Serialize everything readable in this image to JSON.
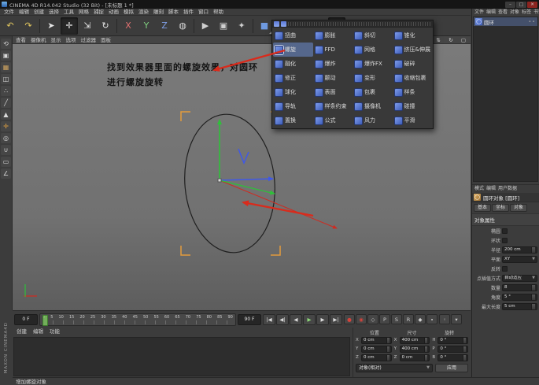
{
  "titlebar": {
    "title": "CINEMA 4D R14.042 Studio (32 Bit) - [未标题 1 *]",
    "minimize": "–",
    "maximize": "□",
    "close": "✕"
  },
  "menubar": {
    "items": [
      "文件",
      "编辑",
      "创建",
      "选择",
      "工具",
      "网格",
      "捕捉",
      "动画",
      "模拟",
      "渲染",
      "雕刻",
      "脚本",
      "插件",
      "窗口",
      "帮助"
    ]
  },
  "toolbar": {
    "icons": [
      {
        "name": "undo-icon",
        "glyph": "↶",
        "color": "#e3c75f"
      },
      {
        "name": "redo-icon",
        "glyph": "↷",
        "color": "#e3c75f"
      },
      {
        "sep": true
      },
      {
        "name": "live-selection-icon",
        "glyph": "➤",
        "color": "#e8e8e8"
      },
      {
        "name": "move-tool-icon",
        "glyph": "✛",
        "color": "#eeeeee",
        "pressed": true
      },
      {
        "name": "scale-tool-icon",
        "glyph": "⇲",
        "color": "#e8e8e8"
      },
      {
        "name": "rotate-tool-icon",
        "glyph": "↻",
        "color": "#e8e8e8"
      },
      {
        "sep": true
      },
      {
        "name": "lock-x-axis-icon",
        "glyph": "X",
        "color": "#e07070"
      },
      {
        "name": "lock-y-axis-icon",
        "glyph": "Y",
        "color": "#7fcf7f"
      },
      {
        "name": "lock-z-axis-icon",
        "glyph": "Z",
        "color": "#7f9fe8"
      },
      {
        "name": "coordinate-system-icon",
        "glyph": "◍",
        "color": "#d8d8d8"
      },
      {
        "sep": true
      },
      {
        "name": "render-view-icon",
        "glyph": "▶",
        "color": "#cfcfcf"
      },
      {
        "name": "render-picture-viewer-icon",
        "glyph": "▣",
        "color": "#cfcfcf"
      },
      {
        "name": "render-settings-icon",
        "glyph": "✦",
        "color": "#cfcfcf"
      },
      {
        "sep": true
      },
      {
        "name": "add-primitive-icon",
        "glyph": "■",
        "color": "#6f9ae0",
        "dd": true
      },
      {
        "name": "add-spline-icon",
        "glyph": "✎",
        "color": "#9fd4ef",
        "dd": true
      },
      {
        "name": "add-generator-icon",
        "glyph": "◥",
        "color": "#7fcf7f",
        "dd": true
      },
      {
        "name": "add-modeling-icon",
        "glyph": "◆",
        "color": "#b08fe0",
        "dd": true
      },
      {
        "name": "add-deformer-icon",
        "glyph": "◈",
        "color": "#8f9fe8",
        "dd": true,
        "pressed": true
      },
      {
        "name": "add-environment-icon",
        "glyph": "▤",
        "color": "#d8b070",
        "dd": true
      },
      {
        "name": "add-camera-icon",
        "glyph": "◉",
        "color": "#cfcfcf",
        "dd": true
      },
      {
        "name": "add-light-icon",
        "glyph": "✺",
        "color": "#eede7a",
        "dd": true
      }
    ]
  },
  "left_rail": {
    "icons": [
      {
        "name": "make-editable-icon",
        "glyph": "⟲",
        "color": "#d9d9d9"
      },
      {
        "name": "model-mode-icon",
        "glyph": "▣",
        "color": "#d9d9d9"
      },
      {
        "name": "texture-mode-icon",
        "glyph": "▦",
        "color": "#cfa45f"
      },
      {
        "name": "workplane-mode-icon",
        "glyph": "◫",
        "color": "#d9d9d9"
      },
      {
        "name": "points-mode-icon",
        "glyph": "∴",
        "color": "#d9d9d9"
      },
      {
        "name": "edges-mode-icon",
        "glyph": "╱",
        "color": "#d9d9d9"
      },
      {
        "name": "polygons-mode-icon",
        "glyph": "▲",
        "color": "#d9d9d9"
      },
      {
        "name": "enable-axis-icon",
        "glyph": "✛",
        "color": "#e0a040"
      },
      {
        "name": "viewport-solo-icon",
        "glyph": "◎",
        "color": "#d9d9d9"
      },
      {
        "name": "enable-snap-icon",
        "glyph": "∪",
        "color": "#d9d9d9"
      },
      {
        "name": "workplane-lock-icon",
        "glyph": "▭",
        "color": "#d9d9d9"
      },
      {
        "name": "quantize-icon",
        "glyph": "∠",
        "color": "#d9d9d9"
      }
    ]
  },
  "viewport": {
    "menu": [
      "查看",
      "摄像机",
      "显示",
      "选项",
      "过滤器",
      "面板"
    ],
    "nav_icons": [
      {
        "name": "viewport-pan-icon",
        "glyph": "⇄"
      },
      {
        "name": "viewport-dolly-icon",
        "glyph": "⇅"
      },
      {
        "name": "viewport-rotate-icon",
        "glyph": "↻"
      },
      {
        "name": "viewport-toggle-icon",
        "glyph": "▢"
      }
    ],
    "annotation": {
      "line1": "找到效果器里面的螺旋效果，对圆环",
      "line2": "进行螺旋旋转"
    }
  },
  "deformer_menu": {
    "items": [
      {
        "en": "bend",
        "label": "扭曲"
      },
      {
        "en": "bulge",
        "label": "膨胀"
      },
      {
        "en": "shear",
        "label": "斜切"
      },
      {
        "en": "taper",
        "label": "锥化"
      },
      {
        "en": "twist",
        "label": "螺旋",
        "highlight": true
      },
      {
        "en": "ffd",
        "label": "FFD"
      },
      {
        "en": "mesh",
        "label": "网格"
      },
      {
        "en": "squash-stretch",
        "label": "挤压&伸展"
      },
      {
        "en": "melt",
        "label": "融化"
      },
      {
        "en": "explosion",
        "label": "爆炸"
      },
      {
        "en": "explosion-fx",
        "label": "爆炸FX"
      },
      {
        "en": "shatter",
        "label": "破碎"
      },
      {
        "en": "correction",
        "label": "修正"
      },
      {
        "en": "jiggle",
        "label": "颤动"
      },
      {
        "en": "morph",
        "label": "变形"
      },
      {
        "en": "shrink-wrap",
        "label": "收缩包裹"
      },
      {
        "en": "spherify",
        "label": "球化"
      },
      {
        "en": "surface",
        "label": "表面"
      },
      {
        "en": "wrap",
        "label": "包裹"
      },
      {
        "en": "spline",
        "label": "样条"
      },
      {
        "en": "spline-rail",
        "label": "导轨"
      },
      {
        "en": "spline-wrap",
        "label": "样条约束"
      },
      {
        "en": "camera",
        "label": "摄像机"
      },
      {
        "en": "collision",
        "label": "碰撞"
      },
      {
        "en": "displacer",
        "label": "置换"
      },
      {
        "en": "formula",
        "label": "公式"
      },
      {
        "en": "wind",
        "label": "风力"
      },
      {
        "en": "smoothing",
        "label": "平滑"
      }
    ]
  },
  "object_manager": {
    "menu": [
      "文件",
      "编辑",
      "查看",
      "对象",
      "标签",
      "书签"
    ],
    "object_label": "圆环",
    "object_icon": "◯"
  },
  "attribute_manager": {
    "menu": [
      "模式",
      "编辑",
      "用户数据"
    ],
    "nav": "◀ ▶",
    "object_label": "圆环对象 [圆环]",
    "tabs": [
      "基本",
      "坐标",
      "对象"
    ],
    "group_title": "对象属性",
    "rows": [
      {
        "label": "椭圆",
        "kind": "check",
        "checked": false
      },
      {
        "label": "环状",
        "kind": "check",
        "checked": false
      },
      {
        "label": "半径",
        "kind": "num",
        "value": "200 cm"
      },
      {
        "label": "平面",
        "kind": "dropdown",
        "value": "XY"
      },
      {
        "label": "反转",
        "kind": "check",
        "checked": false
      },
      {
        "label": "点插值方式",
        "kind": "dropdown",
        "value": "自动适应"
      },
      {
        "label": "数量",
        "kind": "num",
        "value": "8"
      },
      {
        "label": "角度",
        "kind": "num",
        "value": "5 °"
      },
      {
        "label": "最大长度",
        "kind": "num",
        "value": "5 cm"
      }
    ]
  },
  "timeline": {
    "start_label": "0 F",
    "end_label": "90 F",
    "current_frame": 0,
    "ticks": [
      "0",
      "5",
      "10",
      "15",
      "20",
      "25",
      "30",
      "35",
      "40",
      "45",
      "50",
      "55",
      "60",
      "65",
      "70",
      "75",
      "80",
      "85",
      "90"
    ],
    "transport": [
      {
        "name": "go-to-start-button",
        "glyph": "|◀",
        "color": "#dddddd"
      },
      {
        "name": "previous-key-button",
        "glyph": "◀|",
        "color": "#dddddd"
      },
      {
        "name": "previous-frame-button",
        "glyph": "◀",
        "color": "#dddddd"
      },
      {
        "name": "play-button",
        "glyph": "▶",
        "color": "#8fdc7a"
      },
      {
        "name": "next-frame-button",
        "glyph": "▶",
        "color": "#dddddd"
      },
      {
        "name": "go-to-end-button",
        "glyph": "▶|",
        "color": "#dddddd"
      }
    ],
    "record": [
      {
        "name": "record-keyframe-button",
        "glyph": "●",
        "color": "#d4433b"
      },
      {
        "name": "autokey-button",
        "glyph": "◉",
        "color": "#d4433b"
      },
      {
        "name": "keyframe-selection-button",
        "glyph": "◇",
        "color": "#cfcfcf"
      },
      {
        "name": "record-position-button",
        "glyph": "P",
        "color": "#cfcfcf"
      },
      {
        "name": "record-scale-button",
        "glyph": "S",
        "color": "#cfcfcf"
      },
      {
        "name": "record-rotation-button",
        "glyph": "R",
        "color": "#cfcfcf"
      },
      {
        "name": "record-parameter-button",
        "glyph": "◆",
        "color": "#cfcfcf"
      },
      {
        "name": "record-pla-button",
        "glyph": "∙",
        "color": "#cfcfcf"
      }
    ],
    "extra": [
      {
        "name": "snap-toggle-icon",
        "glyph": "◦",
        "color": "#cfcfcf"
      },
      {
        "name": "timeline-options-icon",
        "glyph": "▾",
        "color": "#cfcfcf"
      }
    ]
  },
  "materials": {
    "tabs": [
      "创建",
      "编辑",
      "功能"
    ]
  },
  "coordinates": {
    "columns": [
      {
        "header": "位置",
        "fields": [
          {
            "axis": "X",
            "value": "0 cm"
          },
          {
            "axis": "Y",
            "value": "0 cm"
          },
          {
            "axis": "Z",
            "value": "0 cm"
          }
        ]
      },
      {
        "header": "尺寸",
        "fields": [
          {
            "axis": "X",
            "value": "400 cm"
          },
          {
            "axis": "Y",
            "value": "400 cm"
          },
          {
            "axis": "Z",
            "value": "0 cm"
          }
        ]
      },
      {
        "header": "旋转",
        "fields": [
          {
            "axis": "H",
            "value": "0 °"
          },
          {
            "axis": "P",
            "value": "0 °"
          },
          {
            "axis": "B",
            "value": "0 °"
          }
        ]
      }
    ],
    "mode_value": "对象(相对)",
    "apply_label": "应用"
  },
  "statusbar": {
    "text": "增加螺旋对象"
  },
  "brand": "MAXON  CINEMA4D",
  "colors": {
    "accent_red": "#d92b1c",
    "axis_x": "#cf2a20",
    "axis_y": "#2fbf3a",
    "axis_z": "#3f58e8",
    "selection_orange": "#e39b3c",
    "spline_stroke": "#1f1f1f",
    "play_green": "#8fdc7a"
  }
}
